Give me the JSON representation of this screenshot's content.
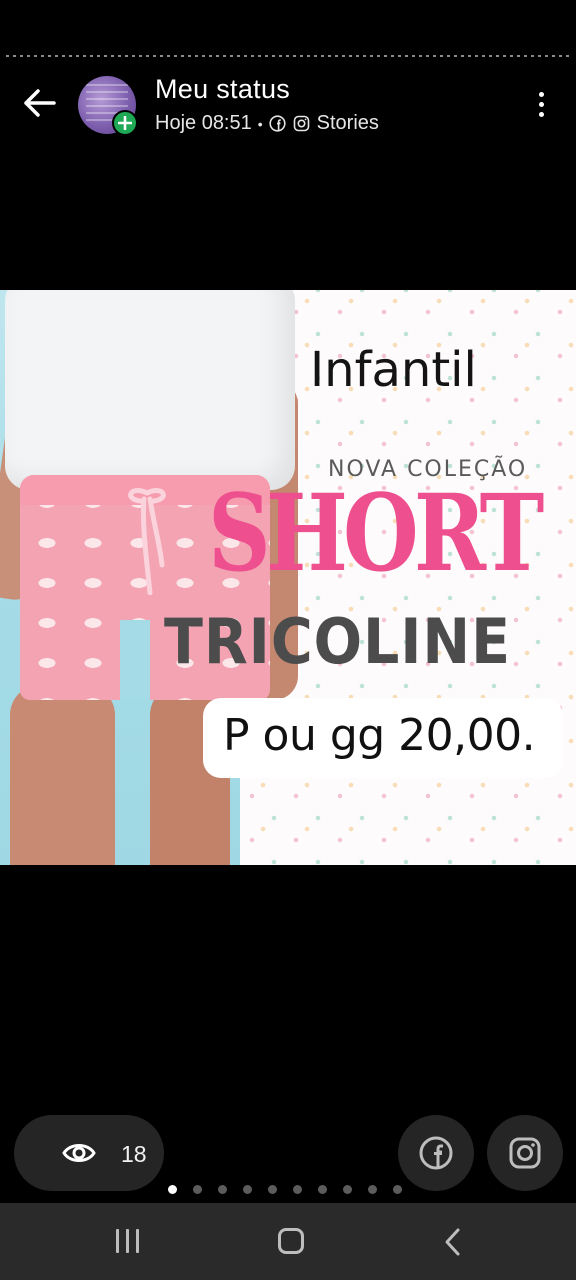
{
  "header": {
    "title": "Meu status",
    "time": "Hoje 08:51",
    "separator": "•",
    "share_label": "Stories"
  },
  "story": {
    "line1": "Infantil",
    "line2": "NOVA COLEÇÃO",
    "line3": "SHORT",
    "line4": "TRICOLINE",
    "price": "P ou gg 20,00.",
    "colors": {
      "short_text": "#ee4f8e",
      "tricoline_text": "#4c4c4c"
    }
  },
  "footer": {
    "views_count": "18",
    "pager": {
      "total": 10,
      "active": 1
    }
  },
  "icons": {
    "back": "arrow-left-icon",
    "menu": "more-vertical-icon",
    "views": "eye-icon",
    "facebook": "facebook-icon",
    "instagram": "instagram-icon"
  }
}
